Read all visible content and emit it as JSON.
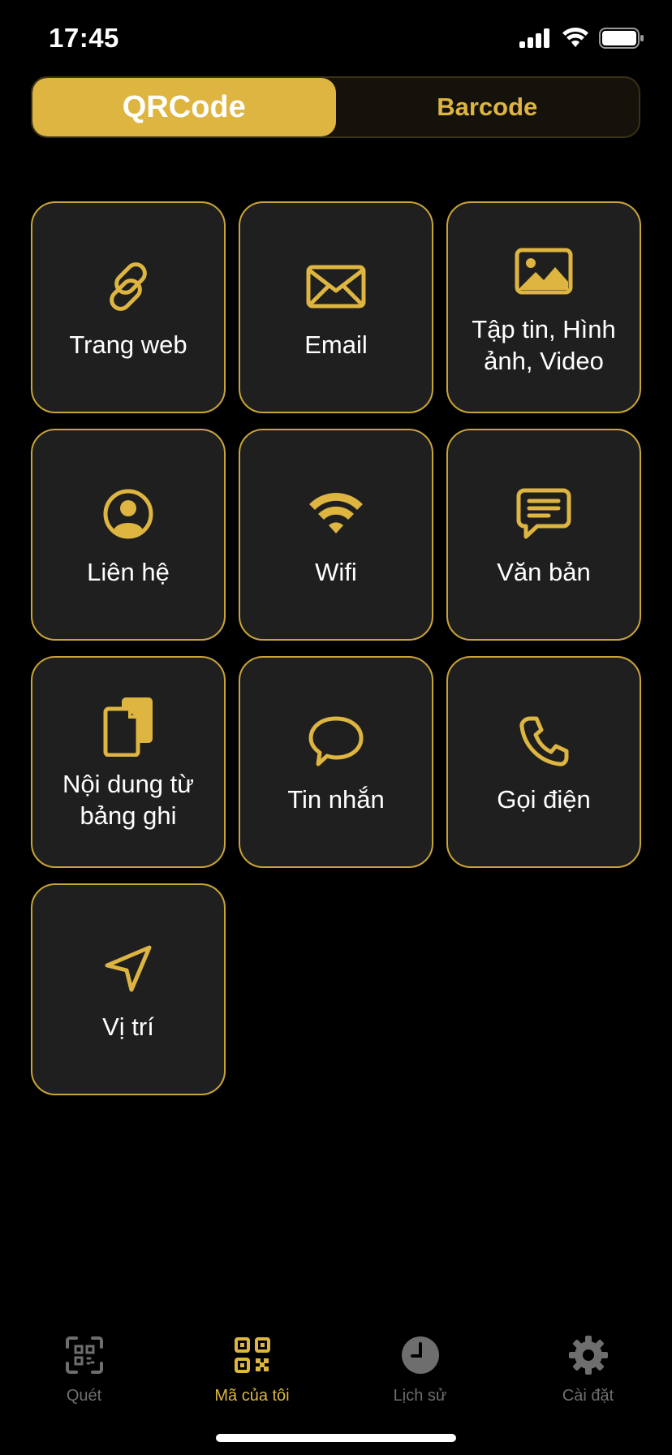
{
  "status_bar": {
    "time": "17:45",
    "icons": [
      "cellular-signal-icon",
      "wifi-icon",
      "battery-icon"
    ]
  },
  "segmented": {
    "tabs": [
      {
        "label": "QRCode",
        "active": true
      },
      {
        "label": "Barcode",
        "active": false
      }
    ]
  },
  "grid": {
    "items": [
      {
        "label": "Trang web",
        "icon": "link-icon"
      },
      {
        "label": "Email",
        "icon": "envelope-icon"
      },
      {
        "label": "Tập tin, Hình ảnh, Video",
        "icon": "image-icon"
      },
      {
        "label": "Liên hệ",
        "icon": "contact-icon"
      },
      {
        "label": "Wifi",
        "icon": "wifi-icon"
      },
      {
        "label": "Văn bản",
        "icon": "text-message-icon"
      },
      {
        "label": "Nội dung từ bảng ghi",
        "icon": "clipboard-icon"
      },
      {
        "label": "Tin nhắn",
        "icon": "chat-bubble-icon"
      },
      {
        "label": "Gọi điện",
        "icon": "phone-icon"
      },
      {
        "label": "Vị trí",
        "icon": "location-arrow-icon"
      }
    ]
  },
  "tabbar": {
    "items": [
      {
        "label": "Quét",
        "icon": "scan-icon",
        "active": false
      },
      {
        "label": "Mã của tôi",
        "icon": "qr-code-icon",
        "active": true
      },
      {
        "label": "Lịch sử",
        "icon": "clock-icon",
        "active": false
      },
      {
        "label": "Cài đặt",
        "icon": "gear-icon",
        "active": false
      }
    ]
  },
  "colors": {
    "accent": "#DDB540",
    "tile_background": "#1f1f1f",
    "tile_border": "#C8A43A",
    "background": "#000000",
    "inactive_tab": "#6e6e6e"
  }
}
